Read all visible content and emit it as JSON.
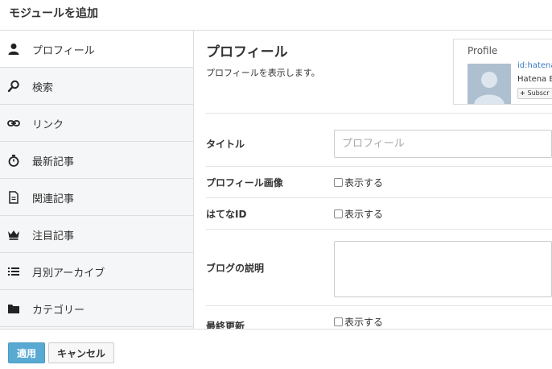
{
  "header": {
    "title": "モジュールを追加"
  },
  "sidebar": {
    "items": [
      {
        "label": "プロフィール",
        "icon": "person-icon",
        "active": true
      },
      {
        "label": "検索",
        "icon": "search-icon"
      },
      {
        "label": "リンク",
        "icon": "link-icon"
      },
      {
        "label": "最新記事",
        "icon": "stopwatch-icon"
      },
      {
        "label": "関連記事",
        "icon": "document-icon"
      },
      {
        "label": "注目記事",
        "icon": "crown-icon"
      },
      {
        "label": "月別アーカイブ",
        "icon": "list-icon"
      },
      {
        "label": "カテゴリー",
        "icon": "folder-icon"
      }
    ]
  },
  "main": {
    "title": "プロフィール",
    "description": "プロフィールを表示します。",
    "preview": {
      "title": "Profile",
      "id_text": "id:hatena",
      "name_text": "Hatena B",
      "subscribe_label": "Subscr"
    },
    "form": {
      "title_label": "タイトル",
      "title_placeholder": "プロフィール",
      "image_label": "プロフィール画像",
      "image_option": "表示する",
      "hatena_id_label": "はてなID",
      "hatena_id_option": "表示する",
      "description_label": "ブログの説明",
      "last_updated_label": "最終更新",
      "last_updated_option": "表示する"
    }
  },
  "footer": {
    "apply_label": "適用",
    "cancel_label": "キャンセル"
  },
  "colors": {
    "accent": "#58aad3",
    "link": "#3a79c4",
    "sidebar_bg": "#f5f6f7"
  }
}
